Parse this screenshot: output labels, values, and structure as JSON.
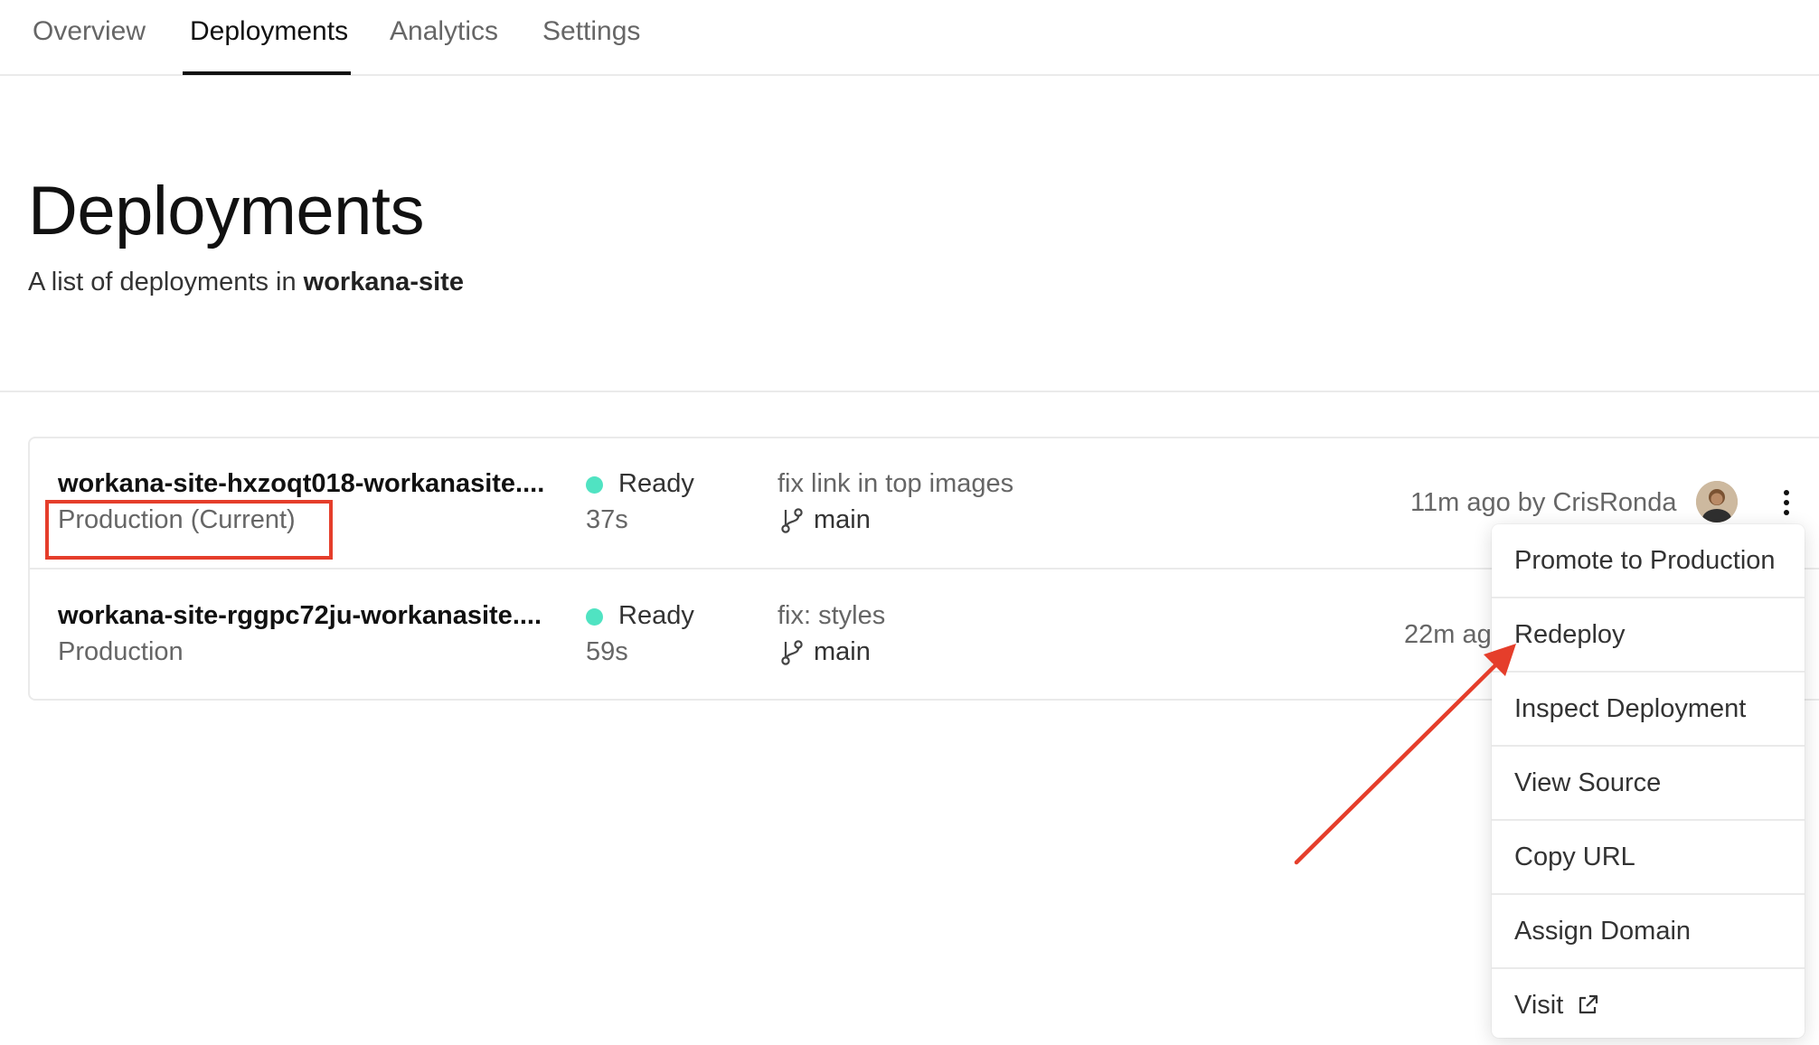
{
  "tabs": [
    {
      "label": "Overview"
    },
    {
      "label": "Deployments",
      "active": true
    },
    {
      "label": "Analytics"
    },
    {
      "label": "Settings"
    }
  ],
  "header": {
    "title": "Deployments",
    "subtitle_prefix": "A list of deployments in ",
    "project": "workana-site"
  },
  "deployments": [
    {
      "name": "workana-site-hxzoqt018-workanasite....",
      "environment": "Production (Current)",
      "status": "Ready",
      "duration": "37s",
      "commit_message": "fix link in top images",
      "branch": "main",
      "meta": "11m ago by CrisRonda"
    },
    {
      "name": "workana-site-rggpc72ju-workanasite....",
      "environment": "Production",
      "status": "Ready",
      "duration": "59s",
      "commit_message": "fix: styles",
      "branch": "main",
      "meta": "22m ag"
    }
  ],
  "menu": {
    "items": [
      {
        "label": "Promote to Production"
      },
      {
        "label": "Redeploy"
      },
      {
        "label": "Inspect Deployment"
      },
      {
        "label": "View Source"
      },
      {
        "label": "Copy URL"
      },
      {
        "label": "Assign Domain"
      },
      {
        "label": "Visit",
        "icon": "external-link-icon"
      }
    ]
  },
  "colors": {
    "status_ready": "#50e3c2",
    "annotation": "#e53e2b",
    "text_primary": "#111111",
    "text_secondary": "#666666",
    "border": "#eaeaea"
  }
}
